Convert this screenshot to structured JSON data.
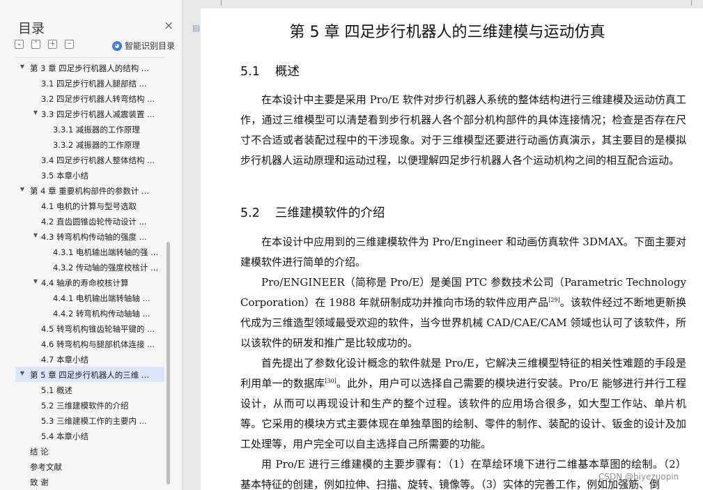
{
  "sidebar": {
    "title": "目录",
    "close_symbol": "×",
    "tools": [
      "⌄",
      "⌃",
      "+",
      "−"
    ],
    "smart_toc_label": "智能识别目录",
    "toc": [
      {
        "label": "第 3 章  四足步行机器人的结构 ...",
        "level": 0,
        "collapsible": true
      },
      {
        "label": "3.1    四足步行机器人腿部结 ...",
        "level": 1,
        "collapsible": false
      },
      {
        "label": "3.2  四足步行机器人转弯结构 ...",
        "level": 1,
        "collapsible": false
      },
      {
        "label": "3.3  四足步行机器人减震装置 ...",
        "level": 1,
        "collapsible": true
      },
      {
        "label": "3.3.1    减振器的工作原理",
        "level": 2,
        "collapsible": false
      },
      {
        "label": "3.3.2    减振器的工作原理",
        "level": 2,
        "collapsible": false
      },
      {
        "label": "3.4  四足步行机器人整体结构 ...",
        "level": 1,
        "collapsible": false
      },
      {
        "label": "3.5   本章小结",
        "level": 1,
        "collapsible": false
      },
      {
        "label": "第 4 章  重要机构部件的参数计 ...",
        "level": 0,
        "collapsible": true
      },
      {
        "label": "4.1    电机的计算与型号选取",
        "level": 1,
        "collapsible": false
      },
      {
        "label": "4.2    直齿圆锥齿轮传动设计 ...",
        "level": 1,
        "collapsible": false
      },
      {
        "label": "4.3    转弯机构传动轴的强度 ...",
        "level": 1,
        "collapsible": true
      },
      {
        "label": "4.3.1  电机输出端转轴的强 ...",
        "level": 2,
        "collapsible": false
      },
      {
        "label": "4.3.2  传动轴的强度校核计 ...",
        "level": 2,
        "collapsible": false
      },
      {
        "label": "4.4    轴承的寿命校核计算",
        "level": 1,
        "collapsible": true
      },
      {
        "label": "4.4.1    电机输出端转轴轴 ...",
        "level": 2,
        "collapsible": false
      },
      {
        "label": "4.4.2    转弯机构传动轴轴 ...",
        "level": 2,
        "collapsible": false
      },
      {
        "label": "4.5  转弯机构锥齿轮轴平键的 ...",
        "level": 1,
        "collapsible": false
      },
      {
        "label": "4.6  转弯机构与腿部机体连接 ...",
        "level": 1,
        "collapsible": false
      },
      {
        "label": "4.7  本章小结",
        "level": 1,
        "collapsible": false
      },
      {
        "label": "第 5 章  四足步行机器人的三维 ...",
        "level": 0,
        "collapsible": true,
        "active": true
      },
      {
        "label": "5.1    概述",
        "level": 1,
        "collapsible": false
      },
      {
        "label": "5.2    三维建模软件的介绍",
        "level": 1,
        "collapsible": false
      },
      {
        "label": "5.3    三维建模工作的主要内 ...",
        "level": 1,
        "collapsible": false
      },
      {
        "label": "5.4    本章小结",
        "level": 1,
        "collapsible": false
      },
      {
        "label": "结    论",
        "level": 0,
        "collapsible": false
      },
      {
        "label": "参考文献",
        "level": 0,
        "collapsible": false
      },
      {
        "label": "致    谢",
        "level": 0,
        "collapsible": false
      }
    ]
  },
  "document": {
    "chapter_title": "第 5 章  四足步行机器人的三维建模与运动仿真",
    "sections": [
      {
        "number": "5.1",
        "title": "概述",
        "paragraphs": [
          "在本设计中主要是采用 Pro/E 软件对步行机器人系统的整体结构进行三维建模及运动仿真工作，通过三维模型可以清楚看到步行机器人各个部分机构部件的具体连接情况；检查是否存在尺寸不合适或者装配过程中的干涉现象。对于三维模型还要进行动画仿真演示，其主要目的是模拟步行机器人运动原理和运动过程，以便理解四足步行机器人各个运动机构之间的相互配合运动。"
        ]
      },
      {
        "number": "5.2",
        "title": "三维建模软件的介绍",
        "paragraphs": [
          "在本设计中应用到的三维建模软件为 Pro/Engineer 和动画仿真软件 3DMAX。下面主要对建模软件进行简单的介绍。",
          "Pro/ENGINEER（简称是 Pro/E）是美国 PTC 参数技术公司（Parametric Technology Corporation）在 1988 年就研制成功并推向市场的软件应用产品[29]。该软件经过不断地更新换代成为三维造型领域最受欢迎的软件，当今世界机械 CAD/CAE/CAM 领域也认可了该软件，所以该软件的研发和推广是比较成功的。",
          "首先提出了参数化设计概念的软件就是 Pro/E，它解决三维模型特征的相关性难题的手段是利用单一的数据库[30]。此外，用户可以选择自己需要的模块进行安装。Pro/E 能够进行并行工程设计，从而可以再现设计和生产的整个过程。该软件的应用场合很多，如大型工作站、单片机等。它采用的模块方式主要体现在单独草图的绘制、零件的制作、装配的设计、钣金的设计及加工处理等，用户完全可以自主选择自己所需要的功能。",
          "用 Pro/E 进行三维建模的主要步骤有：（1）在草绘环境下进行二维基本草图的绘制。（2）基本特征的创建，例如拉伸、扫描、旋转、镜像等。（3）实体的完善工作，例如加强筋、倒"
        ]
      }
    ]
  },
  "watermark": "CSDN @biyezuopin",
  "colors": {
    "active_row": "#dbe6f8",
    "scroll_thumb": "#bdbdbd",
    "smart_icon": "#2a6ae8"
  }
}
